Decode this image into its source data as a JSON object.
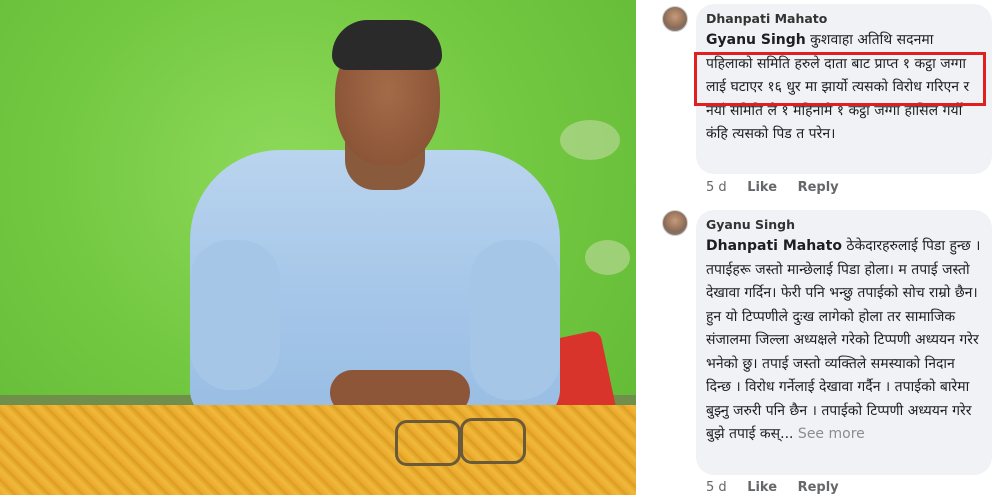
{
  "photo": {
    "alt_icon": "person-photo"
  },
  "comments": [
    {
      "author": "Dhanpati Mahato",
      "mention": "Gyanu Singh",
      "text": " कुशवाहा अतिथि सदनमा पहिलाको समिति हरुले दाता बाट प्राप्त १ कट्ठा जग्गा लाई घटाएर  १६ धुर मा झार्यो त्यसको विरोध गरिएन र  नयाँ समिति ले १ महिनामै १ कट्ठा जग्गा हासिल गर्यो कंहि त्यसको पिड त परेन।",
      "time": "5 d",
      "like": "Like",
      "reply": "Reply"
    },
    {
      "author": "Gyanu Singh",
      "mention": "Dhanpati Mahato",
      "text": " ठेकेदारहरुलाई पिडा हुन्छ ।तपाईहरू जस्तो मान्छेलाई पिडा होला। म तपाई जस्तो देखावा गर्दिन। फेरी पनि भन्छु तपाईको सोच राम्रो छैन। हुन यो टिप्पणीले दुःख लागेको होला तर सामाजिक संजालमा जिल्ला अध्यक्षले गरेको टिप्पणी अध्ययन गरेर भनेको छु। तपाई जस्तो व्यक्तिले समस्याको निदान दिन्छ । विरोध गर्नेलाई देखावा गर्दैन । तपाईको बारेमा बुझ्नु जरुरी पनि छैन । तपाईको टिप्पणी अध्ययन गरेर बुझे तपाई कस्...",
      "see_more": " See more",
      "time": "5 d",
      "like": "Like",
      "reply": "Reply"
    }
  ],
  "colors": {
    "highlight": "#e02020",
    "bubble": "#f0f2f5"
  }
}
